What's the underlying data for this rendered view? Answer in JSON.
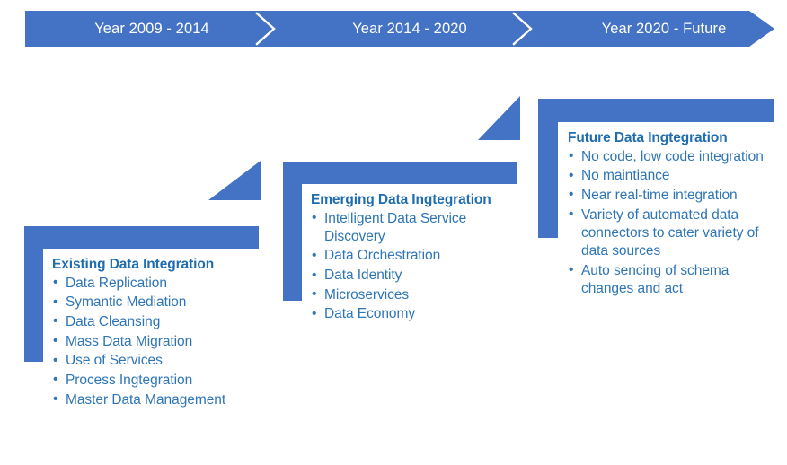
{
  "colors": {
    "accent_blue": "#4472C4",
    "heading_blue": "#1F6DAF",
    "bullet_blue": "#2E75B6",
    "background": "#FFFFFF",
    "banner_text": "#FFFFFF"
  },
  "timeline": {
    "segments": [
      {
        "label": "Year 2009 - 2014"
      },
      {
        "label": "Year 2014 - 2020"
      },
      {
        "label": "Year 2020 - Future"
      }
    ]
  },
  "stages": [
    {
      "title": "Existing Data Integration",
      "items": [
        "Data Replication",
        "Symantic Mediation",
        "Data Cleansing",
        "Mass Data Migration",
        "Use of Services",
        "Process Ingtegration",
        "Master Data Management"
      ]
    },
    {
      "title": "Emerging Data Ingtegration",
      "items": [
        "Intelligent Data Service Discovery",
        "Data Orchestration",
        "Data Identity",
        "Microservices",
        "Data Economy"
      ]
    },
    {
      "title": "Future Data Ingtegration",
      "items": [
        "No code, low code integration",
        "No maintiance",
        "Near real-time integration",
        "Variety of automated data connectors to cater variety of data sources",
        "Auto sencing of schema changes and act"
      ]
    }
  ]
}
